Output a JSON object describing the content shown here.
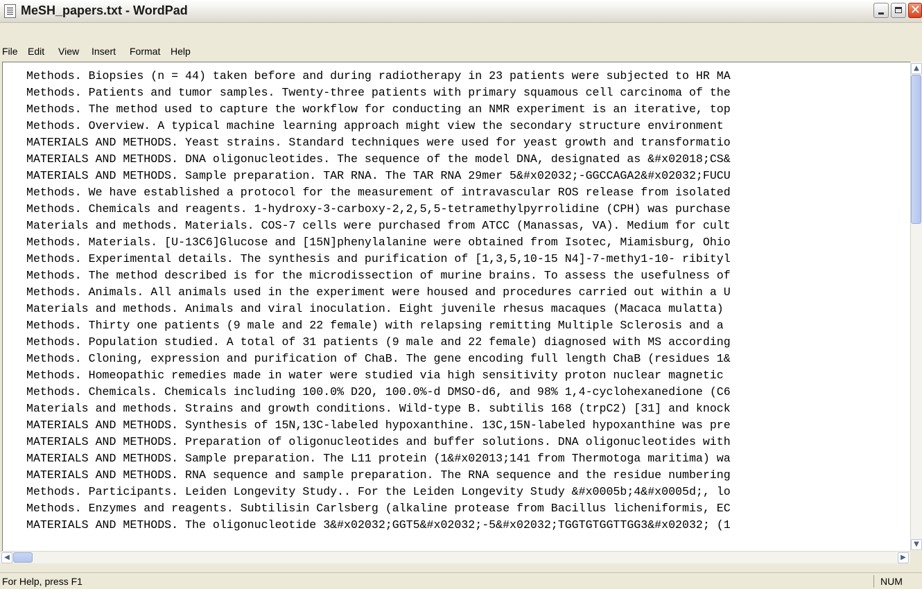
{
  "window": {
    "title": "MeSH_papers.txt - WordPad",
    "icon": "wordpad-document-icon",
    "controls": [
      "minimize-icon",
      "maximize-icon",
      "close-icon"
    ]
  },
  "menubar": {
    "items": [
      "File",
      "Edit",
      "View",
      "Insert",
      "Format",
      "Help"
    ]
  },
  "document": {
    "lines": [
      "Methods. Biopsies (n = 44) taken before and during radiotherapy in 23 patients were subjected to HR MA",
      "Methods. Patients and tumor samples. Twenty-three patients with primary squamous cell carcinoma of the",
      "Methods. The method used to capture the workflow for conducting an NMR experiment is an iterative, top",
      "Methods. Overview. A typical machine learning approach might view the secondary structure environment",
      "MATERIALS AND METHODS. Yeast strains. Standard techniques were used for yeast growth and transformatio",
      "MATERIALS AND METHODS. DNA oligonucleotides. The sequence of the model DNA, designated as &#x02018;CS&",
      "MATERIALS AND METHODS. Sample preparation. TAR RNA. The TAR RNA 29mer 5&#x02032;-GGCCAGA2&#x02032;FUCU",
      "Methods. We have established a protocol for the measurement of intravascular ROS release from isolated",
      "Methods. Chemicals and reagents. 1-hydroxy-3-carboxy-2,2,5,5-tetramethylpyrrolidine (CPH) was purchase",
      "Materials and methods. Materials. COS-7 cells were purchased from ATCC (Manassas, VA). Medium for cult",
      "Methods. Materials. [U-13C6]Glucose and [15N]phenylalanine were obtained from Isotec, Miamisburg, Ohio",
      "Methods. Experimental details. The synthesis and purification of [1,3,5,10-15 N4]-7-methy1-10- ribityl",
      "Methods. The method described is for the microdissection of murine brains. To assess the usefulness of",
      "Methods. Animals. All animals used in the experiment were housed and procedures carried out within a U",
      "Materials and methods. Animals and viral inoculation. Eight juvenile rhesus macaques (Macaca mulatta)",
      "Methods. Thirty one patients (9 male and 22 female) with relapsing remitting Multiple Sclerosis and a",
      "Methods. Population studied. A total of 31 patients (9 male and 22 female) diagnosed with MS according",
      "Methods. Cloning, expression and purification of ChaB. The gene encoding full length ChaB (residues 1&",
      "Methods. Homeopathic remedies made in water were studied via high sensitivity proton nuclear magnetic",
      "Methods. Chemicals. Chemicals including 100.0% D2O, 100.0%-d DMSO-d6, and 98% 1,4-cyclohexanedione (C6",
      "Materials and methods. Strains and growth conditions. Wild-type B. subtilis 168 (trpC2) [31] and knock",
      "MATERIALS AND METHODS. Synthesis of 15N,13C-labeled hypoxanthine. 13C,15N-labeled hypoxanthine was pre",
      "MATERIALS AND METHODS. Preparation of oligonucleotides and buffer solutions. DNA oligonucleotides with",
      "MATERIALS AND METHODS. Sample preparation. The L11 protein (1&#x02013;141 from Thermotoga maritima) wa",
      "MATERIALS AND METHODS. RNA sequence and sample preparation. The RNA sequence and the residue numbering",
      "Methods. Participants. Leiden Longevity Study.. For the Leiden Longevity Study &#x0005b;4&#x0005d;, lo",
      "Methods. Enzymes and reagents. Subtilisin Carlsberg (alkaline protease from Bacillus licheniformis, EC",
      "MATERIALS AND METHODS. The oligonucleotide 3&#x02032;GGT5&#x02032;-5&#x02032;TGGTGTGGTTGG3&#x02032; (1"
    ]
  },
  "scrollbars": {
    "vertical_up": "▲",
    "vertical_down": "▼",
    "horizontal_left": "◀",
    "horizontal_right": "▶"
  },
  "statusbar": {
    "help_text": "For Help, press F1",
    "num_indicator": "NUM"
  }
}
